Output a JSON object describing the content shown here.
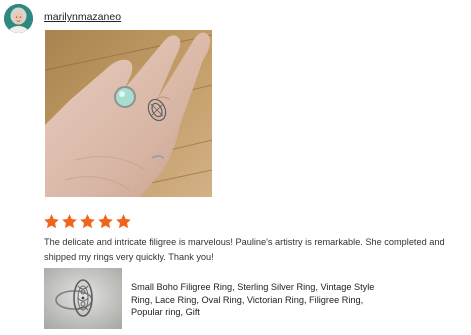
{
  "reviewer": {
    "username": "marilynmazaneo",
    "avatar_icon": "user-avatar-photo"
  },
  "review": {
    "photo_icon": "hand-wearing-rings-photo",
    "rating": 5,
    "rating_max": 5,
    "star_color": "#f1641e",
    "text": "The delicate and intricate filigree is marvelous! Pauline's artistry is remarkable. She completed and shipped my rings very quickly. Thank you!"
  },
  "product": {
    "thumbnail_icon": "filigree-ring-photo",
    "title": "Small Boho Filigree Ring, Sterling Silver Ring, Vintage Style Ring, Lace Ring, Oval Ring, Victorian Ring, Filigree Ring, Popular ring, Gift"
  }
}
